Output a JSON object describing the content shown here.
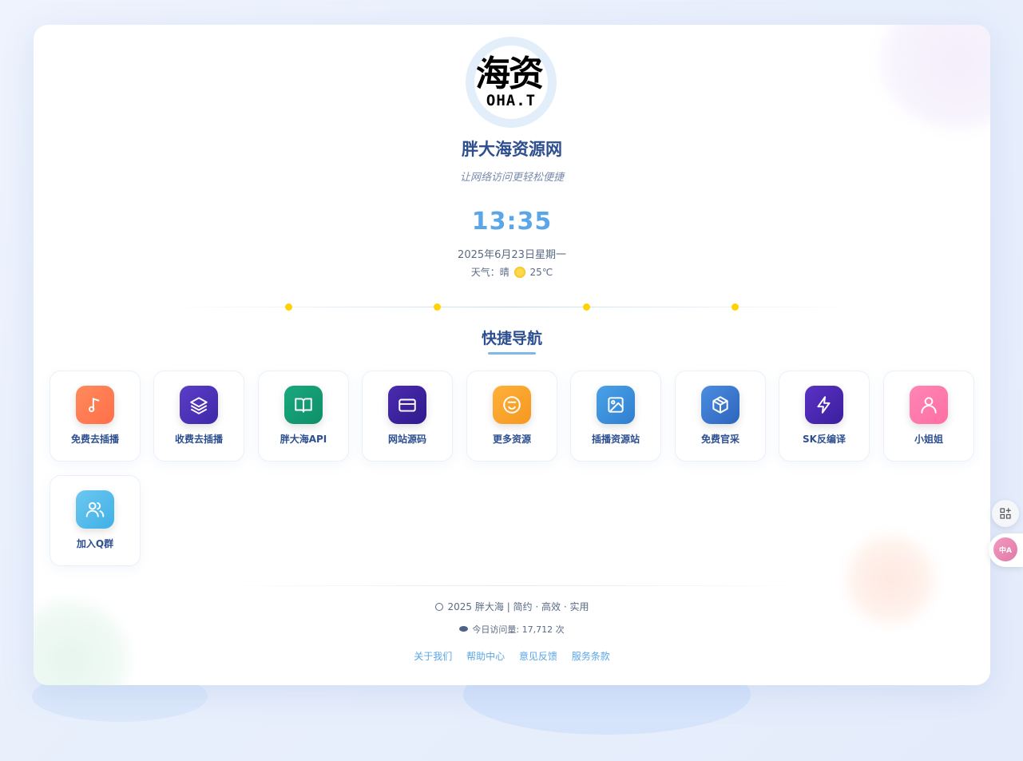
{
  "site": {
    "logo_text_large": "海资",
    "logo_text_small": "OHA.T",
    "title": "胖大海资源网",
    "slogan": "让网络访问更轻松便捷"
  },
  "clock": {
    "time": "13:35",
    "date": "2025年6月23日星期一",
    "weather_label": "天气：晴",
    "weather_icon": "sun-icon",
    "temperature": "25℃"
  },
  "nav": {
    "title": "快捷导航",
    "items": [
      {
        "label": "免费去插播",
        "icon": "music-note-icon",
        "color_from": "#ff8a5c",
        "color_to": "#ff6f4a"
      },
      {
        "label": "收费去插播",
        "icon": "layers-icon",
        "color_from": "#5b3ec8",
        "color_to": "#3e27a8"
      },
      {
        "label": "胖大海API",
        "icon": "book-icon",
        "color_from": "#1aa87e",
        "color_to": "#0e8f68"
      },
      {
        "label": "网站源码",
        "icon": "card-icon",
        "color_from": "#4b2bb0",
        "color_to": "#2f1a8c"
      },
      {
        "label": "更多资源",
        "icon": "smile-icon",
        "color_from": "#ffb03a",
        "color_to": "#f59820"
      },
      {
        "label": "插播资源站",
        "icon": "image-icon",
        "color_from": "#4aa2e8",
        "color_to": "#2f7fd0"
      },
      {
        "label": "免费官采",
        "icon": "box-icon",
        "color_from": "#4b8ee0",
        "color_to": "#2e64bd"
      },
      {
        "label": "SK反编译",
        "icon": "lightning-icon",
        "color_from": "#5a32c4",
        "color_to": "#3b1e9e"
      },
      {
        "label": "小姐姐",
        "icon": "user-icon",
        "color_from": "#ff85b5",
        "color_to": "#ff6fa3"
      },
      {
        "label": "加入Q群",
        "icon": "users-icon",
        "color_from": "#6cc8f0",
        "color_to": "#3fb0e6"
      }
    ]
  },
  "footer": {
    "copyright": "2025 胖大海 | 简约 · 高效 · 实用",
    "visits": "今日访问量: 17,712 次",
    "links": [
      "关于我们",
      "帮助中心",
      "意见反馈",
      "服务条款"
    ]
  },
  "side": {
    "translate_label": "中A"
  }
}
